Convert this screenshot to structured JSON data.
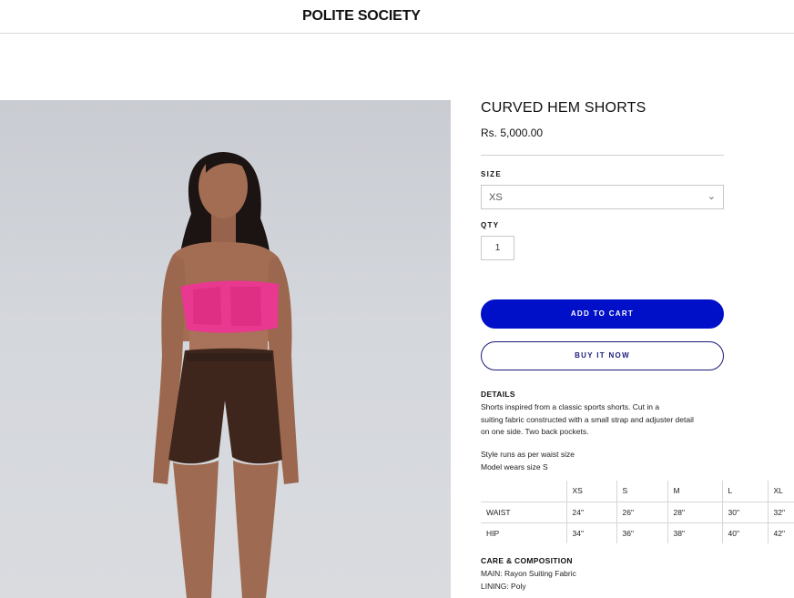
{
  "header": {
    "brand": "POLITE SOCIETY"
  },
  "product": {
    "title": "CURVED HEM SHORTS",
    "price": "Rs. 5,000.00",
    "size_label": "SIZE",
    "size_value": "XS",
    "qty_label": "QTY",
    "qty_value": "1",
    "add_to_cart": "ADD TO CART",
    "buy_now": "BUY IT NOW"
  },
  "details": {
    "title": "DETAILS",
    "lines": [
      "Shorts inspired from a classic sports shorts. Cut in a",
      "suiting fabric constructed with a small strap and adjuster detail",
      "on one side. Two back pockets."
    ],
    "fit_lines": [
      "Style runs as per waist size",
      "Model wears size S"
    ]
  },
  "size_chart": {
    "headers": [
      "",
      "XS",
      "S",
      "M",
      "L",
      "XL"
    ],
    "rows": [
      [
        "WAIST",
        "24\"",
        "26\"",
        "28\"",
        "30\"",
        "32\""
      ],
      [
        "HIP",
        "34\"",
        "36\"",
        "38\"",
        "40\"",
        "42\""
      ]
    ]
  },
  "care": {
    "title": "CARE & COMPOSITION",
    "lines": [
      "MAIN: Rayon Suiting Fabric",
      "LINING: Poly"
    ]
  },
  "colors": {
    "accent": "#0010c8",
    "top": "#e8388f",
    "shorts": "#3e261d",
    "skin": "#a06d54",
    "backdrop": "#d4d7dc"
  }
}
